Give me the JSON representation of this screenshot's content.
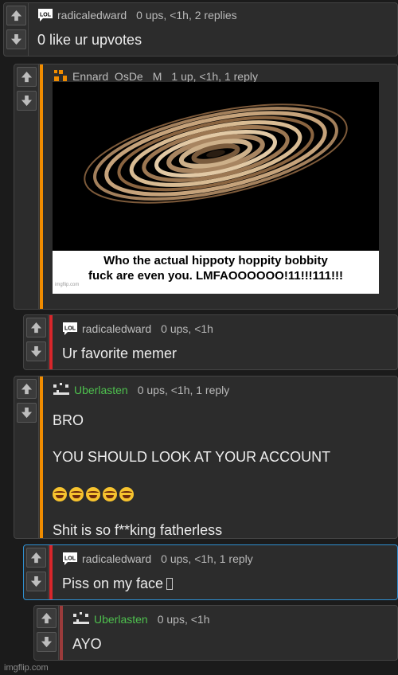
{
  "comments": [
    {
      "username": "radicaledward",
      "badge": "LOL",
      "meta": "0 ups, <1h, 2 replies",
      "lines": [
        "0 like ur upvotes"
      ]
    },
    {
      "username": "Ennard_OsDe",
      "mod": "M",
      "meta": "1 up, <1h, 1 reply",
      "meme_caption_1": "Who the actual hippoty hoppity bobbity",
      "meme_caption_2": "fuck are even you. LMFAOOOOOO!11!!!111!!!",
      "meme_watermark": "imgflip.com"
    },
    {
      "username": "radicaledward",
      "badge": "LOL",
      "meta": "0 ups, <1h",
      "lines": [
        "Ur favorite memer"
      ]
    },
    {
      "username": "Uberlasten",
      "meta": "0 ups, <1h, 1 reply",
      "lines": [
        "BRO",
        "YOU SHOULD LOOK AT YOUR ACCOUNT",
        "",
        "Shit is so f**king fatherless"
      ]
    },
    {
      "username": "radicaledward",
      "badge": "LOL",
      "meta": "0 ups, <1h, 1 reply",
      "lines": [
        "Piss on my face"
      ]
    },
    {
      "username": "Uberlasten",
      "meta": "0 ups, <1h",
      "lines": [
        "AYO"
      ]
    }
  ],
  "footer": "imgflip.com",
  "colors": {
    "orange_bar": "#f08c00",
    "red_bar": "#d8262b",
    "dark_red_bar": "#9b3b3b",
    "username_green": "#4ec04e",
    "highlight_border": "#2f8fcf"
  }
}
